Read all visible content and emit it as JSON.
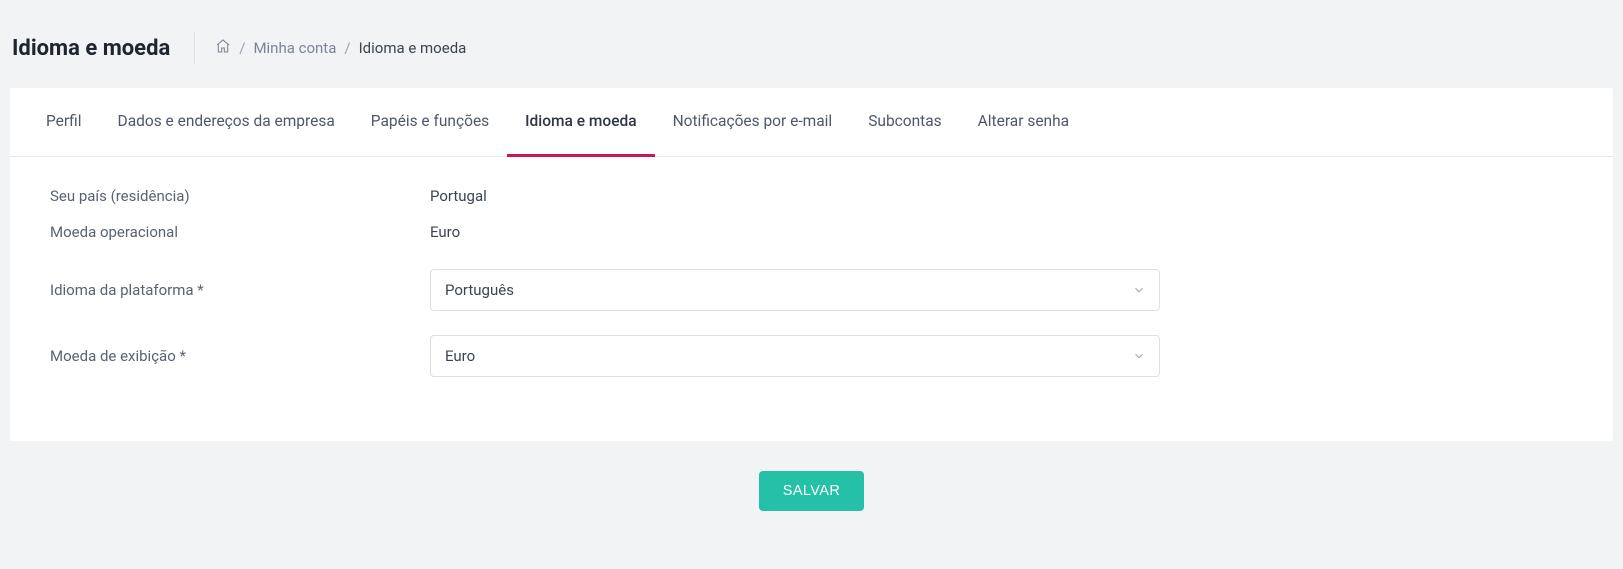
{
  "header": {
    "title": "Idioma e moeda"
  },
  "breadcrumb": {
    "account": "Minha conta",
    "current": "Idioma e moeda"
  },
  "tabs": [
    {
      "label": "Perfil",
      "active": false
    },
    {
      "label": "Dados e endereços da empresa",
      "active": false
    },
    {
      "label": "Papéis e funções",
      "active": false
    },
    {
      "label": "Idioma e moeda",
      "active": true
    },
    {
      "label": "Notificações por e-mail",
      "active": false
    },
    {
      "label": "Subcontas",
      "active": false
    },
    {
      "label": "Alterar senha",
      "active": false
    }
  ],
  "form": {
    "country_label": "Seu país (residência)",
    "country_value": "Portugal",
    "op_currency_label": "Moeda operacional",
    "op_currency_value": "Euro",
    "language_label": "Idioma da plataforma *",
    "language_value": "Português",
    "display_currency_label": "Moeda de exibição *",
    "display_currency_value": "Euro"
  },
  "actions": {
    "save_label": "SALVAR"
  }
}
